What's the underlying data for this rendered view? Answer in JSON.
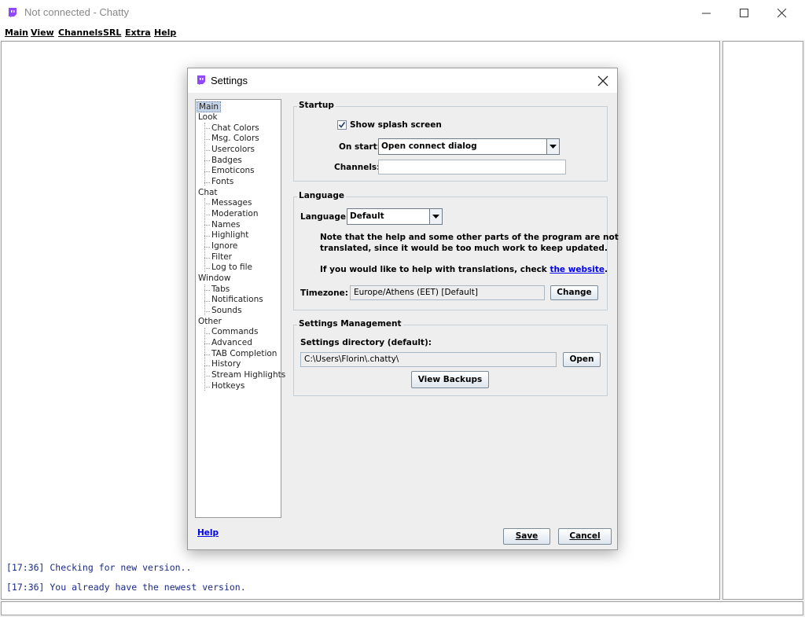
{
  "window": {
    "title": "Not connected - Chatty"
  },
  "menu": [
    "Main",
    "View",
    "Channels",
    "SRL",
    "Extra",
    "Help"
  ],
  "chat": {
    "lines": [
      "[17:36] Checking for new version..",
      "[17:36] You already have the newest version."
    ]
  },
  "dialog": {
    "title": "Settings",
    "help_link": "Help",
    "save_label": "Save",
    "cancel_label": "Cancel"
  },
  "tree": {
    "items": [
      {
        "label": "Main",
        "level": 0,
        "selected": true
      },
      {
        "label": "Look",
        "level": 0
      },
      {
        "label": "Chat Colors",
        "level": 1
      },
      {
        "label": "Msg. Colors",
        "level": 1
      },
      {
        "label": "Usercolors",
        "level": 1
      },
      {
        "label": "Badges",
        "level": 1
      },
      {
        "label": "Emoticons",
        "level": 1
      },
      {
        "label": "Fonts",
        "level": 1
      },
      {
        "label": "Chat",
        "level": 0
      },
      {
        "label": "Messages",
        "level": 1
      },
      {
        "label": "Moderation",
        "level": 1
      },
      {
        "label": "Names",
        "level": 1
      },
      {
        "label": "Highlight",
        "level": 1
      },
      {
        "label": "Ignore",
        "level": 1
      },
      {
        "label": "Filter",
        "level": 1
      },
      {
        "label": "Log to file",
        "level": 1
      },
      {
        "label": "Window",
        "level": 0
      },
      {
        "label": "Tabs",
        "level": 1
      },
      {
        "label": "Notifications",
        "level": 1
      },
      {
        "label": "Sounds",
        "level": 1
      },
      {
        "label": "Other",
        "level": 0
      },
      {
        "label": "Commands",
        "level": 1
      },
      {
        "label": "Advanced",
        "level": 1
      },
      {
        "label": "TAB Completion",
        "level": 1
      },
      {
        "label": "History",
        "level": 1
      },
      {
        "label": "Stream Highlights",
        "level": 1
      },
      {
        "label": "Hotkeys",
        "level": 1
      }
    ]
  },
  "startup": {
    "title": "Startup",
    "splash_label": "Show splash screen",
    "splash_checked": true,
    "onstart_label": "On start:",
    "onstart_value": "Open connect dialog",
    "channels_label": "Channels:",
    "channels_value": ""
  },
  "language": {
    "title": "Language",
    "language_label": "Language:",
    "language_value": "Default",
    "note1": "Note that the help and some other parts of the program are not",
    "note2": "translated, since it would be too much work to keep updated.",
    "help_text": "If you would like to help with translations, check ",
    "help_link": "the website",
    "help_end": ".",
    "timezone_label": "Timezone:",
    "timezone_value": "Europe/Athens (EET) [Default]",
    "change_label": "Change"
  },
  "management": {
    "title": "Settings Management",
    "dir_label": "Settings directory (default):",
    "dir_value": "C:\\Users\\Florin\\.chatty\\",
    "open_label": "Open",
    "backups_label": "View Backups"
  },
  "colors": {
    "brand": "#9146ff",
    "chat_text": "#1a2a8a",
    "link": "#0000ee"
  },
  "icons": {
    "app": "chatty-bubble-icon",
    "minimize": "minimize-icon",
    "maximize": "maximize-icon",
    "close": "close-icon"
  }
}
